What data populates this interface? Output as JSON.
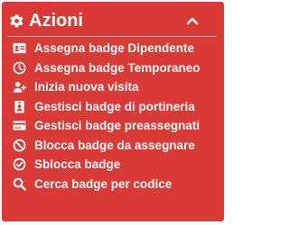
{
  "panel": {
    "title": "Azioni",
    "title_icon": "gear-icon",
    "toggle_icon": "chevron-up-icon",
    "background_color": "#da3a35",
    "text_color": "#ffffff"
  },
  "actions": [
    {
      "label": "Assegna badge Dipendente",
      "icon": "id-card-icon"
    },
    {
      "label": "Assegna badge Temporaneo",
      "icon": "clock-icon"
    },
    {
      "label": "Inizia nuova visita",
      "icon": "user-plus-icon"
    },
    {
      "label": "Gestisci badge di portineria",
      "icon": "id-badge-icon"
    },
    {
      "label": "Gestisci badge preassegnati",
      "icon": "credit-card-icon"
    },
    {
      "label": "Blocca badge da assegnare",
      "icon": "ban-icon"
    },
    {
      "label": "Sblocca badge",
      "icon": "check-circle-icon"
    },
    {
      "label": "Cerca badge per codice",
      "icon": "search-icon"
    }
  ]
}
